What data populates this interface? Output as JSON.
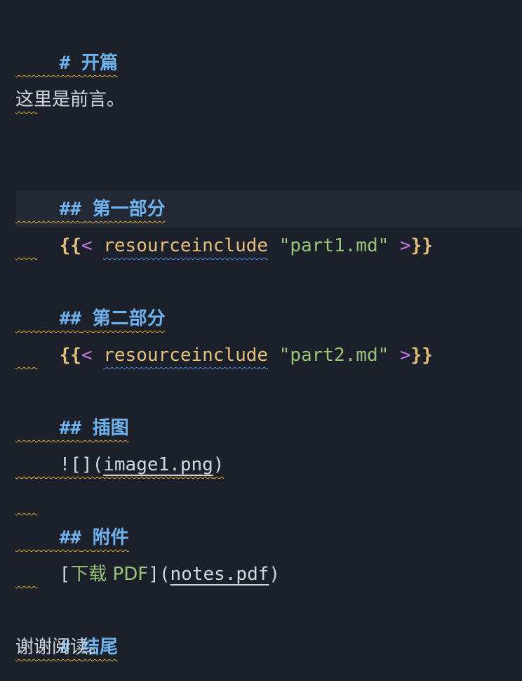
{
  "editor": {
    "lines": {
      "h1_open": {
        "marker": "#",
        "text": "开篇"
      },
      "preface": "这里是前言。",
      "h2_part1": {
        "marker": "##",
        "text": "第一部分"
      },
      "include1": {
        "open": "{{<",
        "name": "resourceinclude",
        "arg": "\"part1.md\"",
        "close": ">}}"
      },
      "h2_part2": {
        "marker": "##",
        "text": "第二部分"
      },
      "include2": {
        "open": "{{<",
        "name": "resourceinclude",
        "arg": "\"part2.md\"",
        "close": ">}}"
      },
      "h2_figure": {
        "marker": "##",
        "text": "插图"
      },
      "image_link": {
        "prefix": "![](",
        "url": "image1.png",
        "suffix": ")"
      },
      "h2_attach": {
        "marker": "##",
        "text": "附件"
      },
      "file_link": {
        "open": "[",
        "label": "下载 PDF",
        "mid": "](",
        "url": "notes.pdf",
        "close": ")"
      },
      "h1_end": {
        "marker": "#",
        "text": "结尾"
      },
      "thanks": "谢谢阅读。"
    },
    "colors": {
      "background": "#1b202a",
      "heading": "#6fb3ee",
      "brace": "#e5c07b",
      "string": "#98c379",
      "warning_squiggle": "#d9a92e",
      "info_squiggle": "#4d86d6"
    }
  }
}
